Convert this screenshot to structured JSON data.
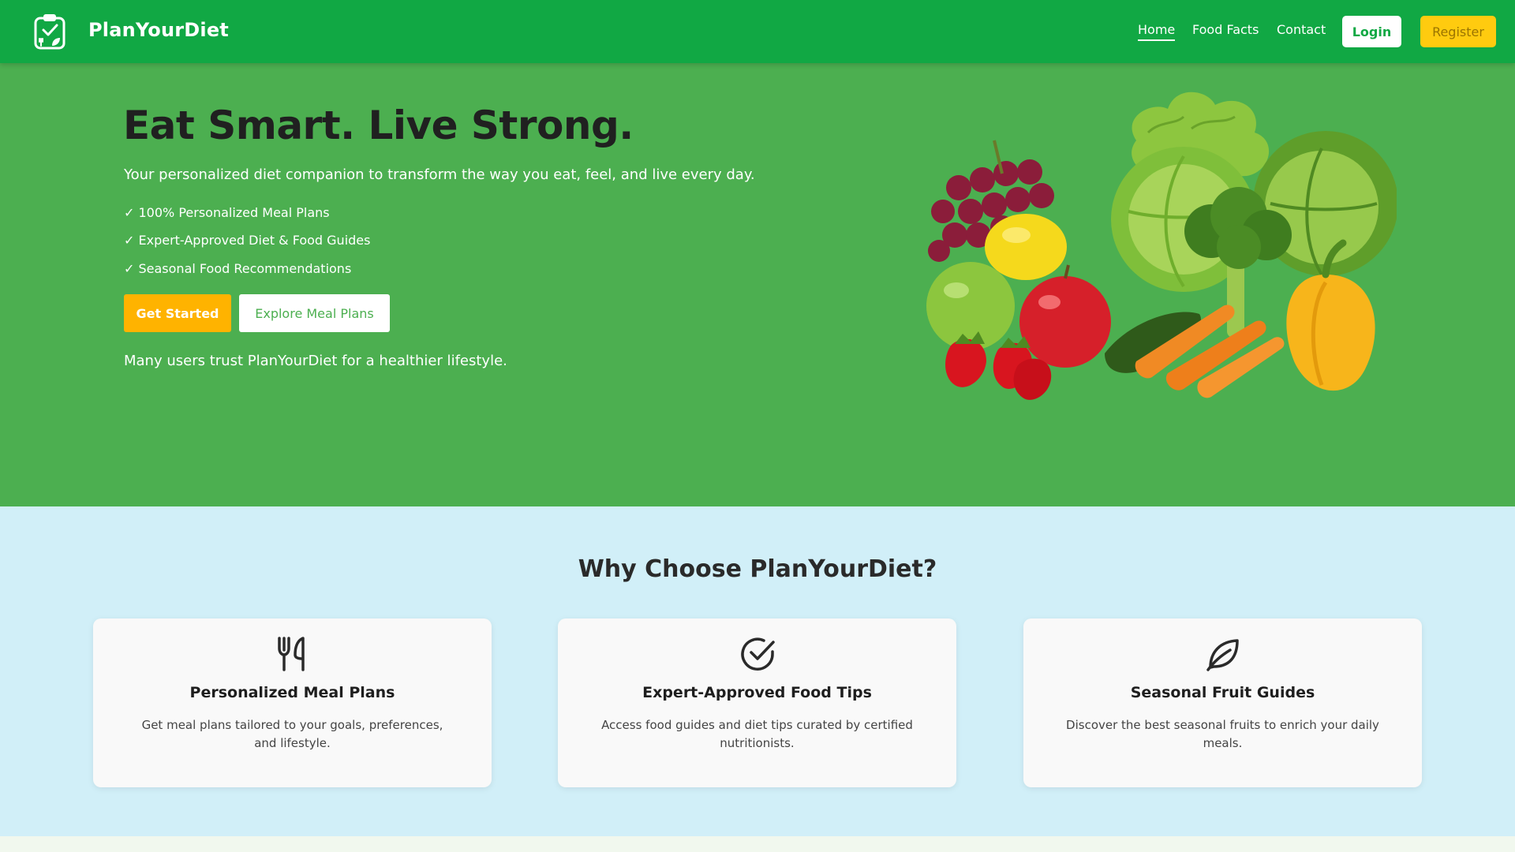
{
  "brand": {
    "name": "PlanYourDiet",
    "logo_icon": "clipboard-leaf-icon"
  },
  "nav": {
    "links": [
      {
        "label": "Home",
        "active": true
      },
      {
        "label": "Food Facts",
        "active": false
      },
      {
        "label": "Contact",
        "active": false
      }
    ],
    "login_label": "Login",
    "register_label": "Register"
  },
  "hero": {
    "title": "Eat Smart. Live Strong.",
    "subtitle": "Your personalized diet companion to transform the way you eat, feel, and live every day.",
    "features": [
      "✓ 100% Personalized Meal Plans",
      "✓ Expert-Approved Diet & Food Guides",
      "✓ Seasonal Food Recommendations"
    ],
    "primary_button": "Get Started",
    "secondary_button": "Explore Meal Plans",
    "trust_text": "Many users trust PlanYourDiet for a healthier lifestyle.",
    "image_icon": "fruits-vegetables-image"
  },
  "why": {
    "title": "Why Choose PlanYourDiet?",
    "cards": [
      {
        "icon": "utensils-icon",
        "title": "Personalized Meal Plans",
        "description": "Get meal plans tailored to your goals, preferences, and lifestyle."
      },
      {
        "icon": "check-circle-icon",
        "title": "Expert-Approved Food Tips",
        "description": "Access food guides and diet tips curated by certified nutritionists."
      },
      {
        "icon": "leaf-icon",
        "title": "Seasonal Fruit Guides",
        "description": "Discover the best seasonal fruits to enrich your daily meals."
      }
    ]
  },
  "colors": {
    "nav_green": "#11a844",
    "hero_green": "#4caf50",
    "accent_yellow": "#ffcb0f",
    "cta_orange": "#ffb300",
    "section_blue": "#d1eff8"
  }
}
